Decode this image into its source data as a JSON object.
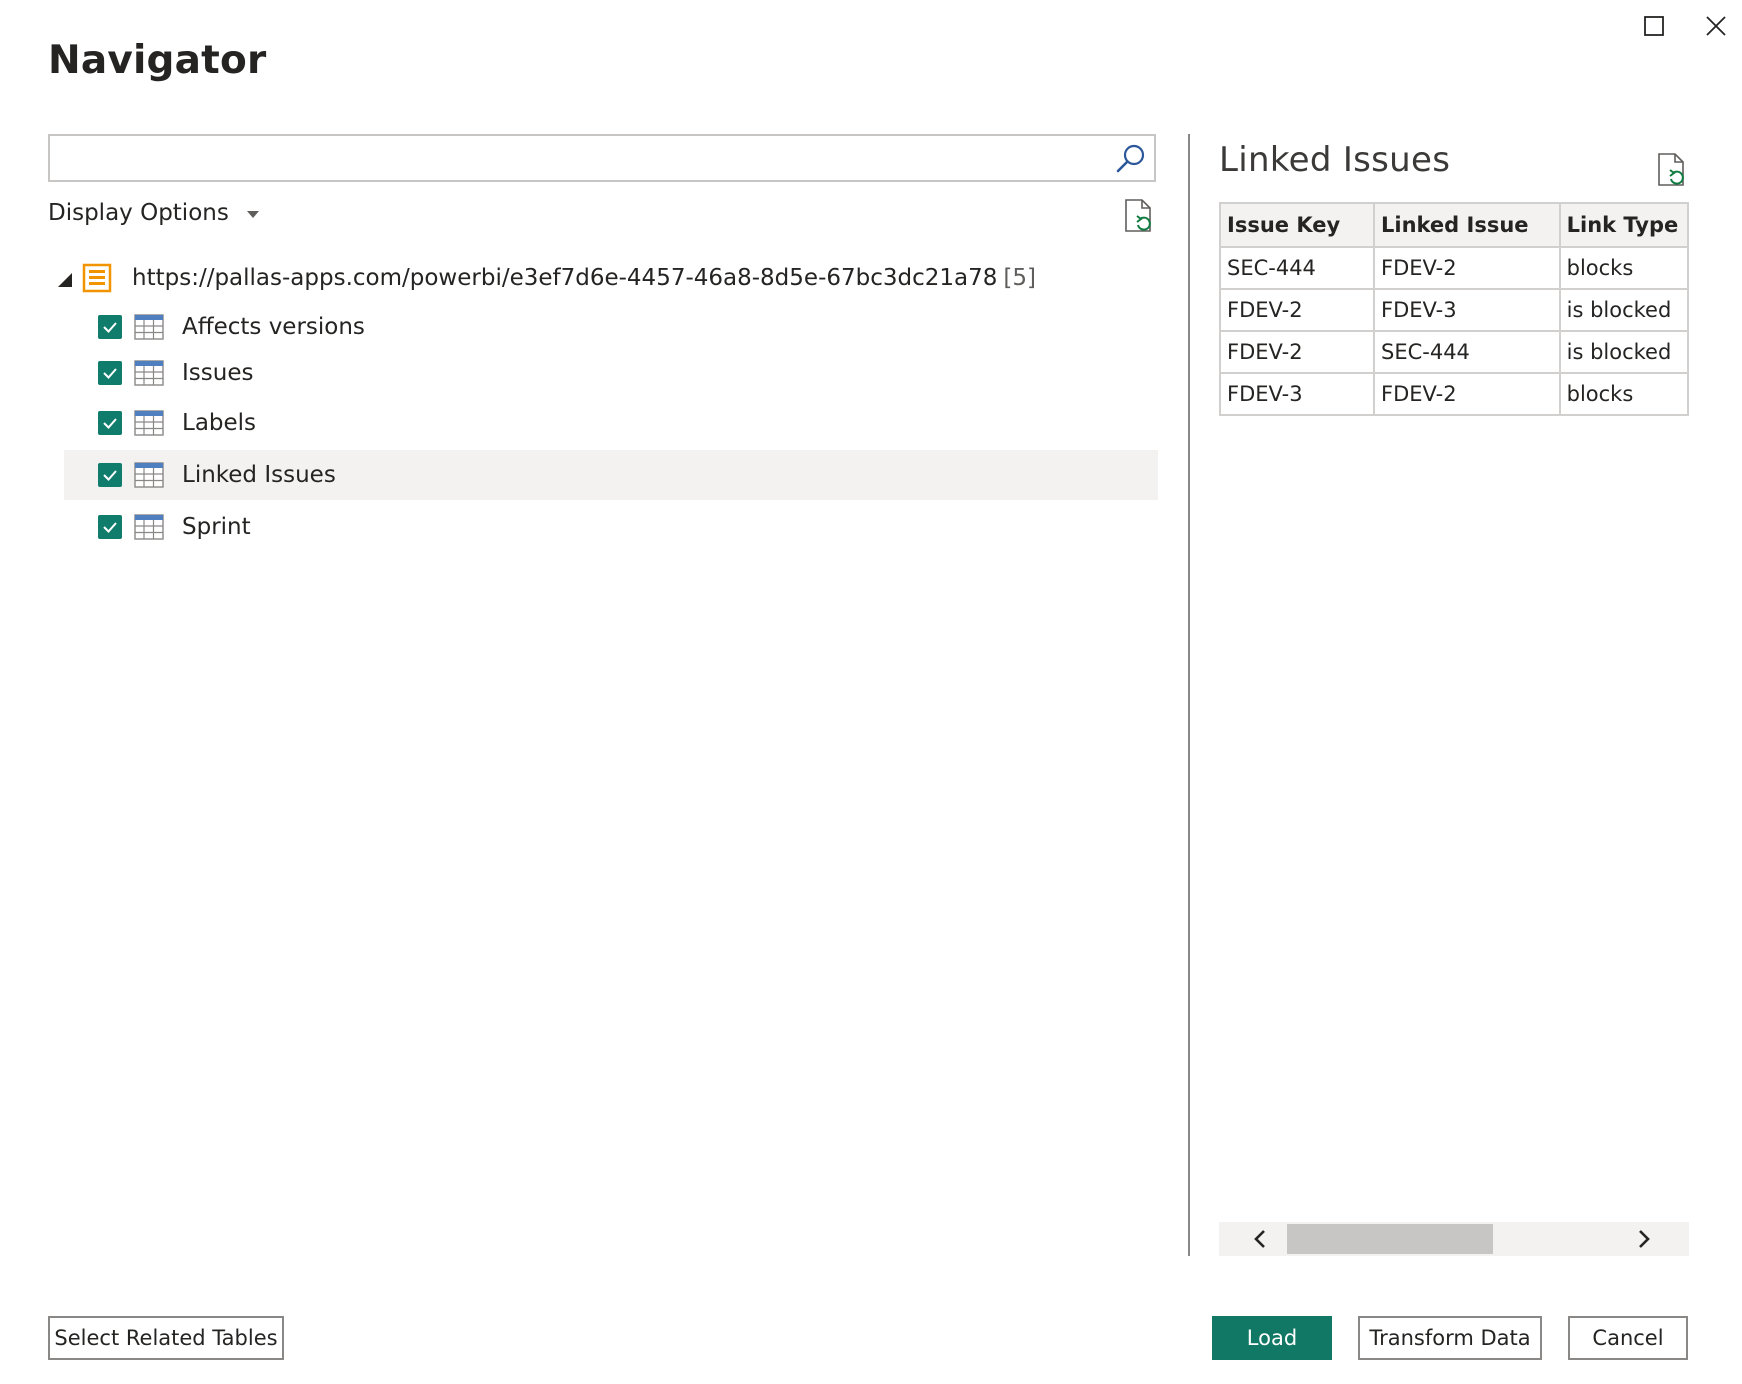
{
  "window": {
    "title": "Navigator",
    "maximize_icon": "maximize-icon",
    "close_icon": "close-icon"
  },
  "search": {
    "value": "",
    "placeholder": "",
    "icon": "search-icon"
  },
  "display_options": {
    "label": "Display Options",
    "icon": "chevron-down-icon"
  },
  "tree": {
    "root": {
      "label": "https://pallas-apps.com/powerbi/e3ef7d6e-4457-46a8-8d5e-67bc3dc21a78",
      "count": "[5]",
      "icon": "database-icon"
    },
    "items": [
      {
        "label": "Affects versions",
        "checked": true,
        "selected": false
      },
      {
        "label": "Issues",
        "checked": true,
        "selected": false
      },
      {
        "label": "Labels",
        "checked": true,
        "selected": false
      },
      {
        "label": "Linked Issues",
        "checked": true,
        "selected": true
      },
      {
        "label": "Sprint",
        "checked": true,
        "selected": false
      }
    ]
  },
  "preview": {
    "title": "Linked Issues",
    "columns": [
      "Issue Key",
      "Linked Issue",
      "Link Type"
    ],
    "rows": [
      [
        "SEC-444",
        "FDEV-2",
        "blocks"
      ],
      [
        "FDEV-2",
        "FDEV-3",
        "is blocked"
      ],
      [
        "FDEV-2",
        "SEC-444",
        "is blocked"
      ],
      [
        "FDEV-3",
        "FDEV-2",
        "blocks"
      ]
    ],
    "scroll_fraction": 0.44
  },
  "buttons": {
    "select_related": "Select Related Tables",
    "load": "Load",
    "transform": "Transform Data",
    "cancel": "Cancel"
  },
  "colors": {
    "accent": "#117865",
    "checkbox": "#107c6c",
    "selected_row": "#f3f2f1",
    "db_icon": "#f29400"
  }
}
